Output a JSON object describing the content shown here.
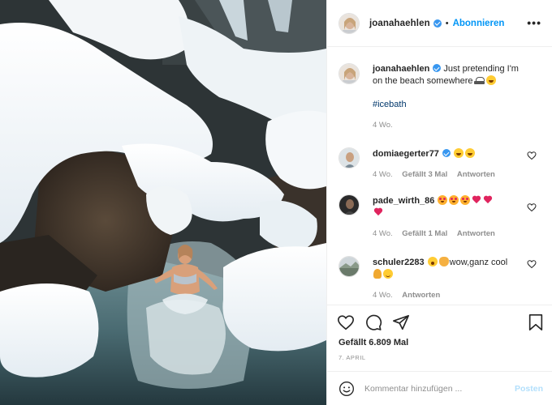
{
  "post": {
    "username": "joanahaehlen",
    "separator": "•",
    "follow_label": "Abonnieren",
    "more_label": "•••",
    "caption_text": "Just pretending I'm on the beach somewhere",
    "caption_emojis": [
      "beach-icon",
      "laugh-icon"
    ],
    "hashtag": "#icebath",
    "caption_time": "4 Wo."
  },
  "comments": [
    {
      "username": "domiaegerter77",
      "text": "",
      "emojis": [
        "laugh-icon",
        "laugh-icon"
      ],
      "time": "4 Wo.",
      "likes": "Gefällt 3 Mal",
      "reply": "Antworten",
      "verified": true
    },
    {
      "username": "pade_wirth_86",
      "text": "",
      "emojis": [
        "heart-eyes-icon",
        "heart-eyes-icon",
        "heart-eyes-icon",
        "red-heart-icon",
        "red-heart-icon",
        "red-heart-icon"
      ],
      "time": "4 Wo.",
      "likes": "Gefällt 1 Mal",
      "reply": "Antworten",
      "verified": false
    },
    {
      "username": "schuler2283",
      "text": "wow,ganz cool",
      "emojis": [
        "wow-icon",
        "clap-icon",
        "hands-icon",
        "smile-icon"
      ],
      "time": "4 Wo.",
      "likes": "",
      "reply": "Antworten",
      "verified": false
    }
  ],
  "engagement": {
    "likes": "Gefällt 6.809 Mal",
    "date": "7. APRIL"
  },
  "add_comment": {
    "placeholder": "Kommentar hinzufügen ...",
    "post_label": "Posten"
  },
  "colors": {
    "accent": "#0095f6",
    "verified": "#3897f0",
    "muted": "#8e8e8e",
    "post_disabled": "#b2dffc",
    "heart_red": "#e0245e"
  }
}
